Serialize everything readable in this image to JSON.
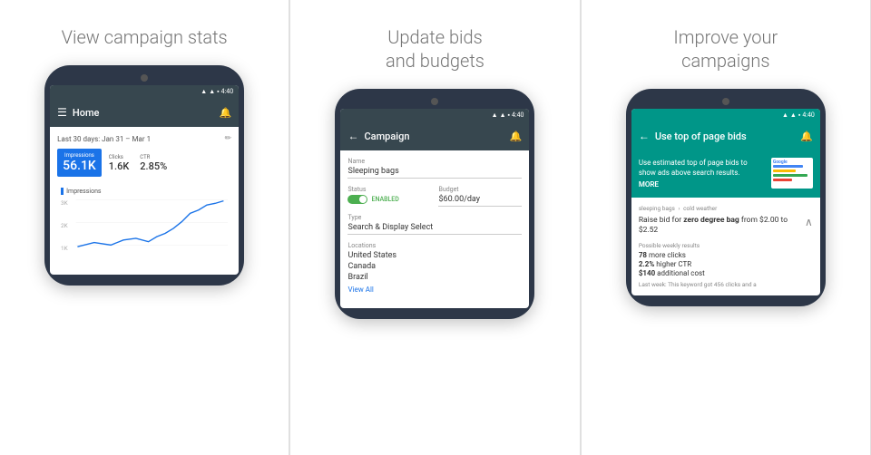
{
  "panels": [
    {
      "id": "panel-1",
      "title": "View campaign stats",
      "appBar": {
        "type": "home",
        "title": "Home",
        "leftIcon": "hamburger",
        "rightIcon": "bell"
      },
      "dateRange": "Last 30 days: Jan 31 – Mar 1",
      "metrics": [
        {
          "label": "Impressions",
          "value": "56.1K",
          "highlight": true
        },
        {
          "label": "Clicks",
          "value": "1.6K"
        },
        {
          "label": "CTR",
          "value": "2.85%"
        }
      ],
      "chartLabel": "Impressions",
      "chartTicks": [
        "3K",
        "2K",
        "1K"
      ]
    },
    {
      "id": "panel-2",
      "title": "Update bids\nand budgets",
      "appBar": {
        "type": "campaign",
        "title": "Campaign",
        "leftIcon": "back",
        "rightIcon": "bell"
      },
      "fields": [
        {
          "label": "Name",
          "value": "Sleeping bags"
        },
        {
          "label": "Status",
          "value": "ENABLED",
          "type": "toggle"
        },
        {
          "label": "Budget",
          "value": "$60.00/day"
        },
        {
          "label": "Type",
          "value": "Search & Display Select"
        },
        {
          "label": "Locations",
          "values": [
            "United States",
            "Canada",
            "Brazil"
          ],
          "link": "View All"
        }
      ]
    },
    {
      "id": "panel-3",
      "title": "Improve your\ncampaigns",
      "appBar": {
        "type": "bids",
        "title": "Use top of page bids",
        "leftIcon": "back",
        "rightIcon": "bell"
      },
      "headerDesc": "Use estimated top of page bids to show ads above search results.",
      "moreLabel": "MORE",
      "breadcrumb": [
        "sleeping bags",
        "cold weather"
      ],
      "bidRaise": {
        "prefix": "Raise bid for ",
        "keyword": "zero degree bag",
        "middle": " from $2.00 to $2.52"
      },
      "possibleResults": {
        "label": "Possible weekly results",
        "rows": [
          {
            "value": "78",
            "unit": "more clicks"
          },
          {
            "value": "2.2%",
            "unit": "higher CTR"
          },
          {
            "value": "$140",
            "unit": "additional cost"
          }
        ]
      },
      "lastWeek": "Last week: This keyword got 456 clicks and a"
    }
  ],
  "statusBar": {
    "time": "4:40",
    "signal": "▲",
    "wifi": "▲",
    "battery": "▪"
  }
}
